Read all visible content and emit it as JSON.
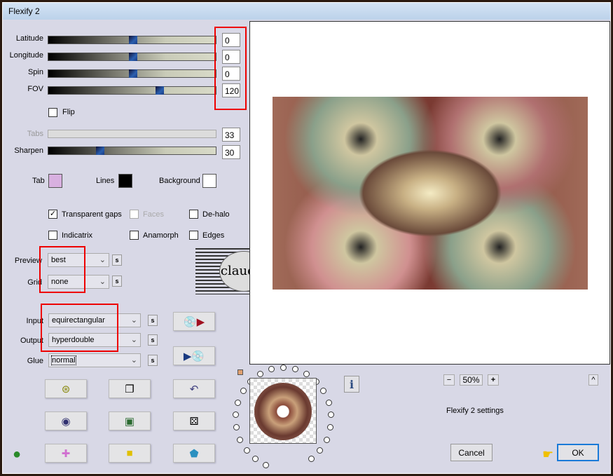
{
  "window": {
    "title": "Flexify 2"
  },
  "sliders": [
    {
      "label": "Latitude",
      "value": "0",
      "fraction": 0.5
    },
    {
      "label": "Longitude",
      "value": "0",
      "fraction": 0.5
    },
    {
      "label": "Spin",
      "value": "0",
      "fraction": 0.5
    },
    {
      "label": "FOV",
      "value": "120",
      "fraction": 0.67
    }
  ],
  "flip": {
    "label": "Flip",
    "checked": false
  },
  "tabs": {
    "label": "Tabs",
    "value": "33",
    "disabled": true
  },
  "sharpen": {
    "label": "Sharpen",
    "value": "30",
    "fraction": 0.3
  },
  "colors": {
    "tab_label": "Tab",
    "tab_color": "#d8b0e0",
    "lines_label": "Lines",
    "lines_color": "#000000",
    "background_label": "Background",
    "background_color": "#ffffff"
  },
  "checkboxes": [
    {
      "label": "Transparent gaps",
      "checked": true
    },
    {
      "label": "Faces",
      "checked": false,
      "disabled": true
    },
    {
      "label": "De-halo",
      "checked": false
    },
    {
      "label": "Indicatrix",
      "checked": false
    },
    {
      "label": "Anamorph",
      "checked": false
    },
    {
      "label": "Edges",
      "checked": false
    }
  ],
  "selects": {
    "preview": {
      "label": "Preview",
      "value": "best"
    },
    "grid": {
      "label": "Grid",
      "value": "none"
    },
    "input": {
      "label": "Input",
      "value": "equirectangular"
    },
    "output": {
      "label": "Output",
      "value": "hyperdouble"
    },
    "glue": {
      "label": "Glue",
      "value": "normal"
    }
  },
  "s_label": "s",
  "watermark": "claudia",
  "zoom": {
    "minus": "−",
    "value": "50%",
    "plus": "+",
    "collapse": "^"
  },
  "status": "Flexify 2 settings",
  "info_label": "i",
  "buttons": {
    "cancel": "Cancel",
    "ok": "OK"
  },
  "accent": "#e00000"
}
